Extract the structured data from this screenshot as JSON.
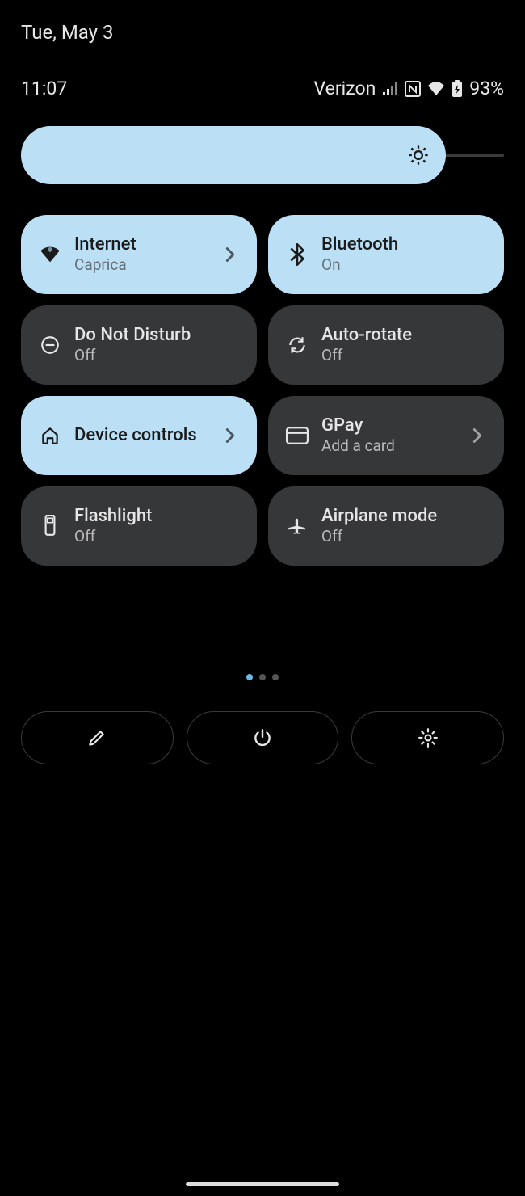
{
  "date": "Tue, May 3",
  "time": "11:07",
  "carrier": "Verizon",
  "battery_pct": "93%",
  "brightness_pct": 88,
  "tiles": [
    {
      "icon": "wifi",
      "label": "Internet",
      "sub": "Caprica",
      "on": true,
      "chevron": true
    },
    {
      "icon": "bluetooth",
      "label": "Bluetooth",
      "sub": "On",
      "on": true,
      "chevron": false
    },
    {
      "icon": "dnd",
      "label": "Do Not Disturb",
      "sub": "Off",
      "on": false,
      "chevron": false
    },
    {
      "icon": "rotate",
      "label": "Auto-rotate",
      "sub": "Off",
      "on": false,
      "chevron": false
    },
    {
      "icon": "home",
      "label": "Device controls",
      "sub": "",
      "on": true,
      "chevron": true
    },
    {
      "icon": "card",
      "label": "GPay",
      "sub": "Add a card",
      "on": false,
      "chevron": true
    },
    {
      "icon": "flash",
      "label": "Flashlight",
      "sub": "Off",
      "on": false,
      "chevron": false
    },
    {
      "icon": "plane",
      "label": "Airplane mode",
      "sub": "Off",
      "on": false,
      "chevron": false
    }
  ],
  "pager": {
    "count": 3,
    "active": 0
  },
  "footer_buttons": [
    "edit",
    "power",
    "settings"
  ]
}
